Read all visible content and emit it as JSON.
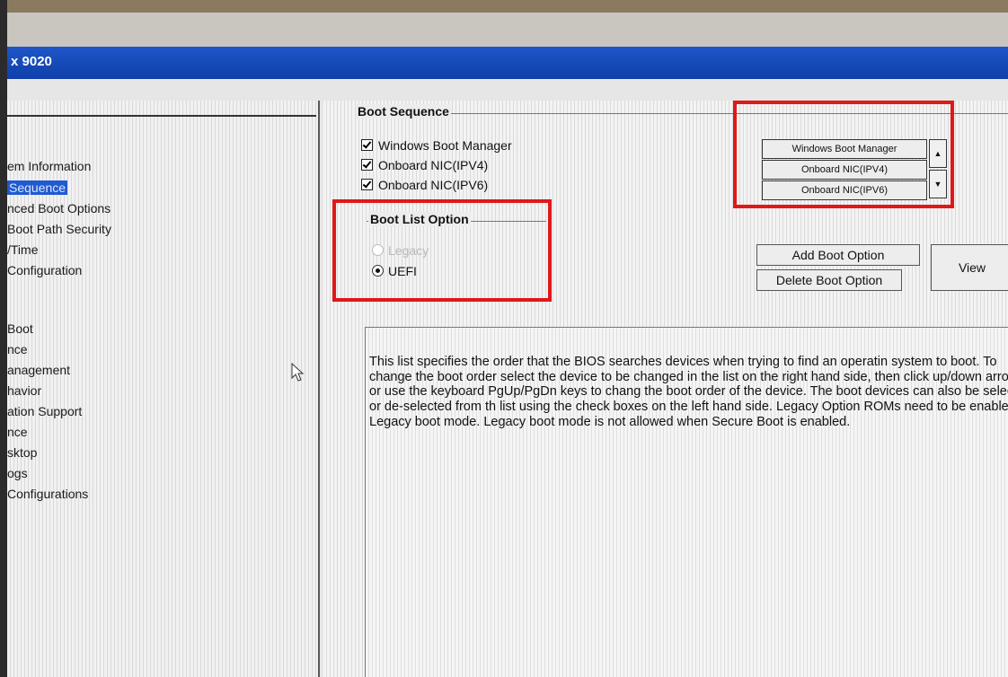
{
  "window": {
    "title": "x 9020"
  },
  "nav": {
    "items": [
      {
        "label": "em Information"
      },
      {
        "label": "Sequence",
        "selected": true
      },
      {
        "label": "nced Boot Options"
      },
      {
        "label": "Boot Path Security"
      },
      {
        "label": "/Time"
      },
      {
        "label": "Configuration"
      },
      {
        "label": "Boot"
      },
      {
        "label": "nce"
      },
      {
        "label": "anagement"
      },
      {
        "label": "havior"
      },
      {
        "label": "ation Support"
      },
      {
        "label": "nce"
      },
      {
        "label": "sktop"
      },
      {
        "label": "ogs"
      },
      {
        "label": "Configurations"
      }
    ]
  },
  "boot_sequence": {
    "title": "Boot Sequence",
    "items": [
      {
        "label": "Windows Boot Manager",
        "checked": true
      },
      {
        "label": "Onboard NIC(IPV4)",
        "checked": true
      },
      {
        "label": "Onboard NIC(IPV6)",
        "checked": true
      }
    ],
    "order_list": [
      "Windows Boot Manager",
      "Onboard NIC(IPV4)",
      "Onboard NIC(IPV6)"
    ],
    "up_glyph": "▲",
    "down_glyph": "▼"
  },
  "boot_list_option": {
    "title": "Boot List Option",
    "options": [
      {
        "label": "Legacy",
        "selected": false,
        "enabled": false
      },
      {
        "label": "UEFI",
        "selected": true,
        "enabled": true
      }
    ]
  },
  "buttons": {
    "add": "Add Boot Option",
    "delete": "Delete Boot Option",
    "view": "View"
  },
  "description": "This list specifies the order that the BIOS searches devices when trying to find an operatin system to boot. To change the boot order select the device to be changed in the list on the right hand side, then click up/down arrows or use the keyboard PgUp/PgDn keys to chang the boot order of the device. The boot devices can also be selected or de-selected from th list using the check boxes on the left hand side. Legacy Option ROMs need to be enabled Legacy boot mode. Legacy boot mode is not allowed when Secure Boot is enabled.",
  "colors": {
    "highlight": "#e01818",
    "titlebar": "#1f56c9",
    "selection": "#1f5ad0"
  }
}
